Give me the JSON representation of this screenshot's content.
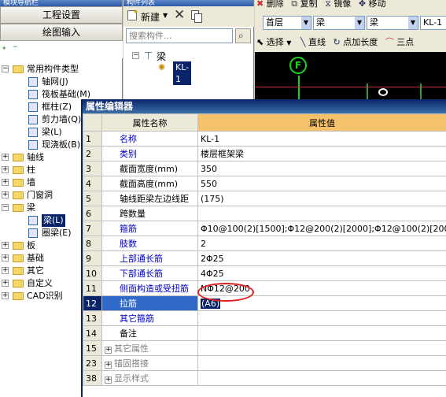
{
  "nav": {
    "panel_title": "模块导航栏",
    "project_settings": "工程设置",
    "drawing_input": "绘图输入",
    "tree": [
      {
        "label": "常用构件类型",
        "expanded": true,
        "level": 0
      },
      {
        "label": "轴网(J)",
        "level": 1
      },
      {
        "label": "筏板基础(M)",
        "level": 1
      },
      {
        "label": "框柱(Z)",
        "level": 1
      },
      {
        "label": "剪力墙(Q)",
        "level": 1
      },
      {
        "label": "梁(L)",
        "level": 1
      },
      {
        "label": "现浇板(B)",
        "level": 1
      },
      {
        "label": "轴线",
        "level": 0
      },
      {
        "label": "柱",
        "level": 0
      },
      {
        "label": "墙",
        "level": 0
      },
      {
        "label": "门窗洞",
        "level": 0
      },
      {
        "label": "梁",
        "expanded": true,
        "level": 0
      },
      {
        "label": "梁(L)",
        "level": 1,
        "selected": true
      },
      {
        "label": "圈梁(E)",
        "level": 1
      },
      {
        "label": "板",
        "level": 0
      },
      {
        "label": "基础",
        "level": 0
      },
      {
        "label": "其它",
        "level": 0
      },
      {
        "label": "自定义",
        "level": 0
      },
      {
        "label": "CAD识别",
        "level": 0
      }
    ]
  },
  "list": {
    "panel_title": "构件列表",
    "new_label": "新建",
    "search_placeholder": "搜索构件...",
    "tree_root": "梁",
    "tree_child": "KL-1"
  },
  "toolbar": {
    "delete_label": "删除",
    "copy_label": "复制",
    "mirror_label": "镜像",
    "move_label": "移动",
    "floor_combo": "首层",
    "type_combo": "梁",
    "sub_combo": "梁",
    "name_combo": "KL-1",
    "select_label": "选择",
    "line_label": "直线",
    "point_length_label": "点加长度",
    "three_point_label": "三点",
    "axis_marker": "F"
  },
  "editor": {
    "title": "属性编辑器",
    "col_name": "属性名称",
    "col_value": "属性值",
    "rows": [
      {
        "num": "1",
        "name": "名称",
        "value": "KL-1",
        "style": "blue"
      },
      {
        "num": "2",
        "name": "类别",
        "value": "楼层框架梁",
        "style": "blue"
      },
      {
        "num": "3",
        "name": "截面宽度(mm)",
        "value": "350",
        "style": "black"
      },
      {
        "num": "4",
        "name": "截面高度(mm)",
        "value": "550",
        "style": "black"
      },
      {
        "num": "5",
        "name": "轴线距梁左边线距",
        "value": "(175)",
        "style": "black"
      },
      {
        "num": "6",
        "name": "跨数量",
        "value": "",
        "style": "black"
      },
      {
        "num": "7",
        "name": "箍筋",
        "value": "Φ10@100(2)[1500];Φ12@200(2)[2000];Φ12@100(2)[2000]",
        "style": "blue"
      },
      {
        "num": "8",
        "name": "肢数",
        "value": "2",
        "style": "blue"
      },
      {
        "num": "9",
        "name": "上部通长筋",
        "value": "2Φ25",
        "style": "blue"
      },
      {
        "num": "10",
        "name": "下部通长筋",
        "value": "4Φ25",
        "style": "blue"
      },
      {
        "num": "11",
        "name": "侧面构造或受扭筋",
        "value": "NΦ12@200",
        "style": "blue"
      },
      {
        "num": "12",
        "name": "拉筋",
        "value": "(A6)",
        "style": "current"
      },
      {
        "num": "13",
        "name": "其它箍筋",
        "value": "",
        "style": "blue"
      },
      {
        "num": "14",
        "name": "备注",
        "value": "",
        "style": "black"
      },
      {
        "num": "15",
        "name": "其它属性",
        "value": "",
        "style": "group"
      },
      {
        "num": "23",
        "name": "锚固搭接",
        "value": "",
        "style": "group"
      },
      {
        "num": "38",
        "name": "显示样式",
        "value": "",
        "style": "group"
      }
    ]
  }
}
